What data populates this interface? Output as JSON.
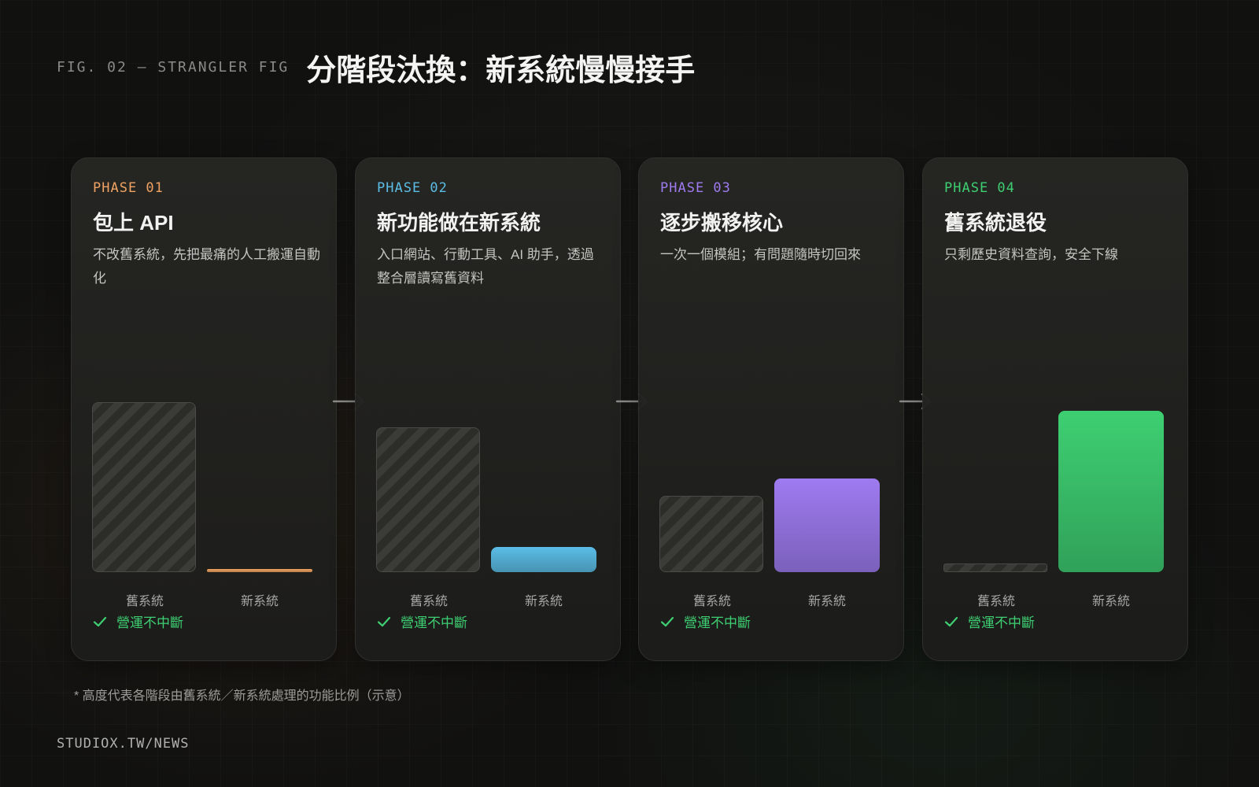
{
  "header": {
    "fig_label": "FIG. 02 — STRANGLER FIG",
    "title": "分階段汰換：新系統慢慢接手"
  },
  "footnote": "* 高度代表各階段由舊系統／新系統處理的功能比例（示意）",
  "footer_url": "STUDIOX.TW/NEWS",
  "colors": {
    "phase_01": "#f0a262",
    "phase_02": "#5bbde6",
    "phase_03": "#9e7bf0",
    "phase_04": "#3ecf72",
    "status": "#3ecf72",
    "arrow": "#8a8a86"
  },
  "icons": {
    "status": "check-icon",
    "connector": "arrow-right-icon"
  },
  "phases": [
    {
      "label": "PHASE 01",
      "title": "包上 API",
      "desc": "不改舊系統，先把最痛的人工搬運自動化",
      "old_label": "舊系統",
      "new_label": "新系統",
      "status": "營運不中斷"
    },
    {
      "label": "PHASE 02",
      "title": "新功能做在新系統",
      "desc": "入口網站、行動工具、AI 助手，透過整合層讀寫舊資料",
      "old_label": "舊系統",
      "new_label": "新系統",
      "status": "營運不中斷"
    },
    {
      "label": "PHASE 03",
      "title": "逐步搬移核心",
      "desc": "一次一個模組；有問題隨時切回來",
      "old_label": "舊系統",
      "new_label": "新系統",
      "status": "營運不中斷"
    },
    {
      "label": "PHASE 04",
      "title": "舊系統退役",
      "desc": "只剩歷史資料查詢，安全下線",
      "old_label": "舊系統",
      "new_label": "新系統",
      "status": "營運不中斷"
    }
  ],
  "chart_data": {
    "type": "bar",
    "categories": [
      "PHASE 01",
      "PHASE 02",
      "PHASE 03",
      "PHASE 04"
    ],
    "series": [
      {
        "name": "舊系統",
        "values": [
          100,
          85,
          45,
          5
        ]
      },
      {
        "name": "新系統",
        "values": [
          1,
          15,
          55,
          95
        ]
      }
    ],
    "title": "分階段汰換：新系統慢慢接手",
    "note": "* 高度代表各階段由舊系統／新系統處理的功能比例（示意）",
    "ylim": [
      0,
      100
    ],
    "grid": false
  }
}
